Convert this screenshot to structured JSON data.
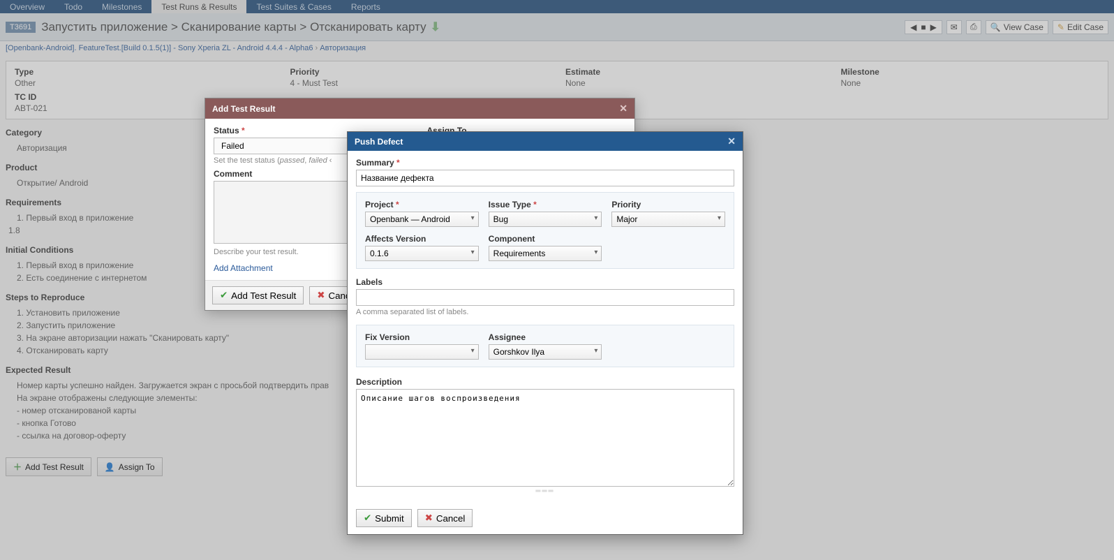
{
  "topnav": {
    "tabs": [
      {
        "label": "Overview"
      },
      {
        "label": "Todo"
      },
      {
        "label": "Milestones"
      },
      {
        "label": "Test Runs & Results"
      },
      {
        "label": "Test Suites & Cases"
      },
      {
        "label": "Reports"
      }
    ],
    "active_index": 3
  },
  "header": {
    "test_id": "T3691",
    "title": "Запустить приложение > Сканирование карты > Отсканировать карту",
    "nav_prev": "◀",
    "nav_stop": "■",
    "nav_next": "▶",
    "view_case": "View Case",
    "edit_case": "Edit Case"
  },
  "subcrumb": {
    "part1": "[Openbank-Android]. FeatureTest.[Build 0.1.5(1)] - Sony Xperia ZL - Android 4.4.4 - Alpha6",
    "sep": "›",
    "part2": "Авторизация"
  },
  "details": {
    "type": {
      "label": "Type",
      "value": "Other"
    },
    "priority": {
      "label": "Priority",
      "value": "4 - Must Test"
    },
    "estimate": {
      "label": "Estimate",
      "value": "None"
    },
    "milestone": {
      "label": "Milestone",
      "value": "None"
    },
    "tcid": {
      "label": "TC ID",
      "value": "ABT-021"
    }
  },
  "sections": {
    "category": {
      "title": "Category",
      "value": "Авторизация"
    },
    "product": {
      "title": "Product",
      "value": "Открытие/ Android"
    },
    "requirements": {
      "title": "Requirements",
      "items": [
        "Первый вход в приложение"
      ],
      "extra": "1.8"
    },
    "initial": {
      "title": "Initial Conditions",
      "items": [
        "Первый вход в приложение",
        "Есть соединение с интернетом"
      ]
    },
    "steps": {
      "title": "Steps to Reproduce",
      "items": [
        "Установить приложение",
        "Запустить приложение",
        "На экране авторизации нажать \"Сканировать карту\"",
        "Отсканировать карту"
      ]
    },
    "expected": {
      "title": "Expected Result",
      "lines": [
        "Номер карты успешно найден. Загружается экран с просьбой подтвердить прав",
        "На экране отображены следующие элементы:",
        "- номер отсканированой карты",
        "- кнопка Готово",
        "- ссылка на договор-оферту"
      ]
    }
  },
  "bottom": {
    "add_test_result": "Add Test Result",
    "assign_to": "Assign To"
  },
  "dialog1": {
    "title": "Add Test Result",
    "status_label": "Status",
    "status_value": "Failed",
    "status_hint_part1": "Set the test status (",
    "status_hint_passed": "passed",
    "status_hint_sep": ", ",
    "status_hint_failed": "failed",
    "status_hint_part2": " ‹",
    "assign_label": "Assign To",
    "comment_label": "Comment",
    "comment_hint": "Describe your test result.",
    "add_attachment": "Add Attachment",
    "submit": "Add Test Result",
    "cancel": "Cance"
  },
  "dialog2": {
    "title": "Push Defect",
    "summary_label": "Summary",
    "summary_value": "Название дефекта",
    "project_label": "Project",
    "project_value": "Openbank — Android",
    "issuetype_label": "Issue Type",
    "issuetype_value": "Bug",
    "priority_label": "Priority",
    "priority_value": "Major",
    "affects_label": "Affects Version",
    "affects_value": "0.1.6",
    "component_label": "Component",
    "component_value": "Requirements",
    "labels_label": "Labels",
    "labels_hint": "A comma separated list of labels.",
    "fixversion_label": "Fix Version",
    "fixversion_value": "",
    "assignee_label": "Assignee",
    "assignee_value": "Gorshkov Ilya",
    "description_label": "Description",
    "description_value": "Описание шагов воспроизведения",
    "submit": "Submit",
    "cancel": "Cancel"
  }
}
